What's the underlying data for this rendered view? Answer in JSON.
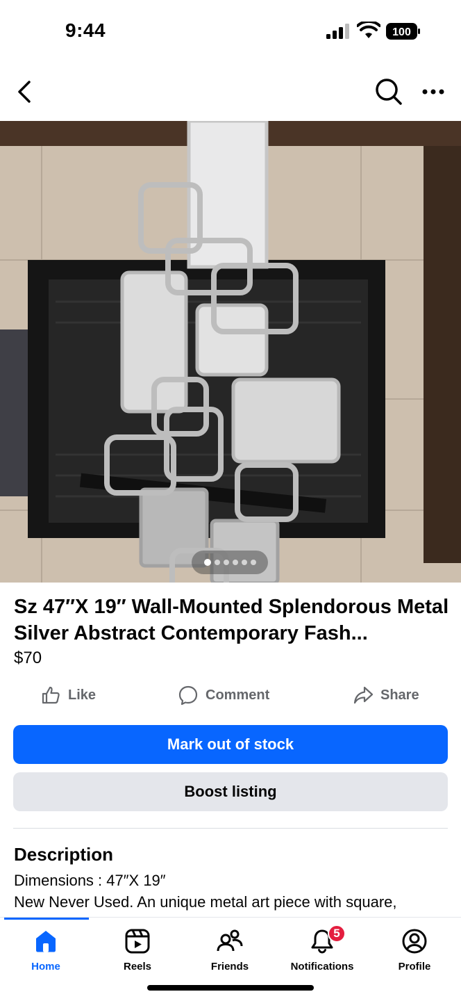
{
  "status": {
    "time": "9:44",
    "battery": "100"
  },
  "listing": {
    "title": "Sz 47″X 19″ Wall-Mounted Splendorous Metal Silver Abstract Contemporary Fash...",
    "price": "$70",
    "photo_count": 6,
    "current_photo": 1
  },
  "actions": {
    "like": "Like",
    "comment": "Comment",
    "share": "Share"
  },
  "buttons": {
    "mark_out": "Mark out of stock",
    "boost": "Boost listing"
  },
  "description": {
    "heading": "Description",
    "line1": "Dimensions : 47″X 19″",
    "line2": "New Never Used. An unique metal art piece with square,"
  },
  "tabs": [
    {
      "label": "Home",
      "icon": "home-icon"
    },
    {
      "label": "Reels",
      "icon": "reels-icon"
    },
    {
      "label": "Friends",
      "icon": "friends-icon"
    },
    {
      "label": "Notifications",
      "icon": "bell-icon",
      "badge": "5"
    },
    {
      "label": "Profile",
      "icon": "profile-icon"
    }
  ],
  "colors": {
    "accent": "#0866ff",
    "badge": "#e41e3f"
  }
}
